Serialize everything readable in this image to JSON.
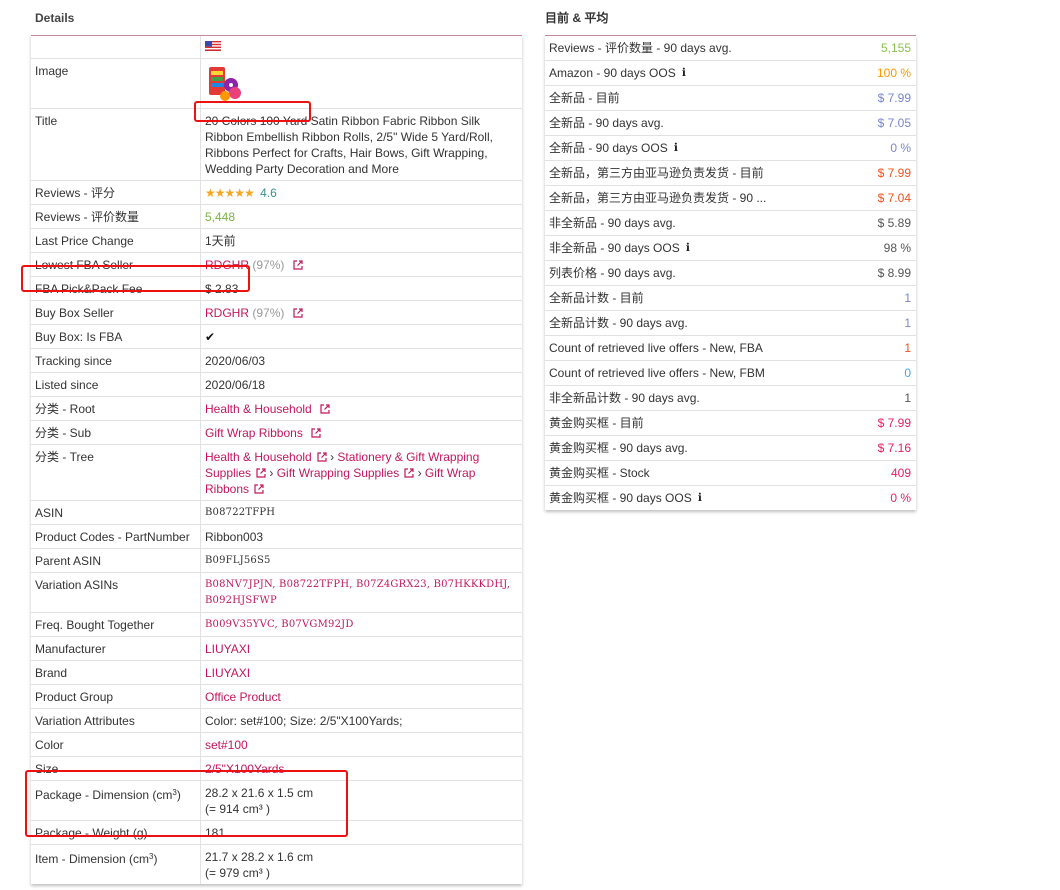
{
  "details": {
    "title": "Details",
    "rows": {
      "image_label": "Image",
      "title_label": "Title",
      "title_value": "20 Colors 100 Yard Satin Ribbon Fabric Ribbon Silk Ribbon Embellish Ribbon Rolls, 2/5\" Wide 5 Yard/Roll, Ribbons Perfect for Crafts, Hair Bows, Gift Wrapping, Wedding Party Decoration and More",
      "rating_label": "Reviews - 评分",
      "rating_stars": "★★★★★",
      "rating_value": "4.6",
      "review_count_label": "Reviews - 评价数量",
      "review_count_value": "5,448",
      "last_price_change_label": "Last Price Change",
      "last_price_change_value": "1天前",
      "lowest_fba_label": "Lowest FBA Seller",
      "lowest_fba_seller": "RDGHR",
      "lowest_fba_pct": "(97%)",
      "fba_fee_label": "FBA Pick&Pack Fee",
      "fba_fee_value": "$ 2.83",
      "buybox_seller_label": "Buy Box Seller",
      "buybox_seller": "RDGHR",
      "buybox_seller_pct": "(97%)",
      "buybox_fba_label": "Buy Box: Is FBA",
      "buybox_fba_value": "✔",
      "tracking_since_label": "Tracking since",
      "tracking_since_value": "2020/06/03",
      "listed_since_label": "Listed since",
      "listed_since_value": "2020/06/18",
      "cat_root_label": "分类 - Root",
      "cat_root_value": "Health & Household",
      "cat_sub_label": "分类 - Sub",
      "cat_sub_value": "Gift Wrap Ribbons",
      "cat_tree_label": "分类 - Tree",
      "cat_tree_1": "Health & Household",
      "cat_tree_2": "Stationery & Gift Wrapping Supplies",
      "cat_tree_3": "Gift Wrapping Supplies",
      "cat_tree_4": "Gift Wrap Ribbons",
      "tree_sep": "›",
      "asin_label": "ASIN",
      "asin_value": "B08722TFPH",
      "part_number_label": "Product Codes - PartNumber",
      "part_number_value": "Ribbon003",
      "parent_asin_label": "Parent ASIN",
      "parent_asin_value": "B09FLJ56S5",
      "variation_asins_label": "Variation ASINs",
      "variation_asins": [
        "B08NV7JPJN,",
        "B08722TFPH,",
        "B07Z4GRX23,",
        "B07HKKKDHJ,",
        "B092HJSFWP"
      ],
      "fbt_label": "Freq. Bought Together",
      "fbt": [
        "B009V35YVC,",
        "B07VGM92JD"
      ],
      "manufacturer_label": "Manufacturer",
      "manufacturer_value": "LIUYAXI",
      "brand_label": "Brand",
      "brand_value": "LIUYAXI",
      "product_group_label": "Product Group",
      "product_group_value": "Office Product",
      "variation_attr_label": "Variation Attributes",
      "variation_attr_value": "Color: set#100; Size: 2/5\"X100Yards;",
      "color_label": "Color",
      "color_value": "set#100",
      "size_label": "Size",
      "size_value": "2/5\"X100Yards",
      "pkg_dim_label": "Package - Dimension (cm",
      "pkg_dim_sup": "3",
      "pkg_dim_label_close": ")",
      "pkg_dim_value": "28.2 x 21.6 x 1.5 cm",
      "pkg_dim_volume": "(= 914 cm³ )",
      "pkg_weight_label": "Package - Weight (g)",
      "pkg_weight_value": "181",
      "item_dim_label": "Item - Dimension (cm",
      "item_dim_sup": "3",
      "item_dim_label_close": ")",
      "item_dim_value": "21.7 x 28.2 x 1.6 cm",
      "item_dim_volume": "(= 979 cm³ )"
    }
  },
  "current": {
    "title": "目前 & 平均",
    "rows": [
      {
        "label": "Reviews - 评价数量 - 90 days avg.",
        "value": "5,155",
        "info": false,
        "color": "#8bc34a"
      },
      {
        "label": "Amazon - 90 days OOS",
        "value": "100 %",
        "info": true,
        "color": "#ff9800"
      },
      {
        "label": "全新品 - 目前",
        "value": "$ 7.99",
        "info": false,
        "color": "#7986cb"
      },
      {
        "label": "全新品 - 90 days avg.",
        "value": "$ 7.05",
        "info": false,
        "color": "#7986cb"
      },
      {
        "label": "全新品 - 90 days OOS",
        "value": "0 %",
        "info": true,
        "color": "#7986cb"
      },
      {
        "label": "全新品，第三方由亚马逊负责发货 - 目前",
        "value": "$ 7.99",
        "info": false,
        "color": "#f4511e"
      },
      {
        "label": "全新品，第三方由亚马逊负责发货 - 90 ...",
        "value": "$ 7.04",
        "info": false,
        "color": "#f4511e"
      },
      {
        "label": "非全新品 - 90 days avg.",
        "value": "$ 5.89",
        "info": false,
        "color": "#555555"
      },
      {
        "label": "非全新品 - 90 days OOS",
        "value": "98 %",
        "info": true,
        "color": "#555555"
      },
      {
        "label": "列表价格 - 90 days avg.",
        "value": "$ 8.99",
        "info": false,
        "color": "#555555"
      },
      {
        "label": "全新品计数 - 目前",
        "value": "1",
        "info": false,
        "color": "#7986cb"
      },
      {
        "label": "全新品计数 - 90 days avg.",
        "value": "1",
        "info": false,
        "color": "#7986cb"
      },
      {
        "label": "Count of retrieved live offers - New, FBA",
        "value": "1",
        "info": false,
        "color": "#f4511e"
      },
      {
        "label": "Count of retrieved live offers - New, FBM",
        "value": "0",
        "info": false,
        "color": "#42a5f5"
      },
      {
        "label": "非全新品计数 - 90 days avg.",
        "value": "1",
        "info": false,
        "color": "#555555"
      },
      {
        "label": "黄金购买框 - 目前",
        "value": "$ 7.99",
        "info": false,
        "color": "#e91e63"
      },
      {
        "label": "黄金购买框 - 90 days avg.",
        "value": "$ 7.16",
        "info": false,
        "color": "#e91e63"
      },
      {
        "label": "黄金购买框 - Stock",
        "value": "409",
        "info": false,
        "color": "#e91e63"
      },
      {
        "label": "黄金购买框 - 90 days OOS",
        "value": "0 %",
        "info": true,
        "color": "#e91e63"
      }
    ],
    "info_icon": "ℹ"
  },
  "colors": {
    "accent_pink": "#c2185b",
    "highlight_red": "#ee1111",
    "table_top_border": "#c48a9a"
  }
}
